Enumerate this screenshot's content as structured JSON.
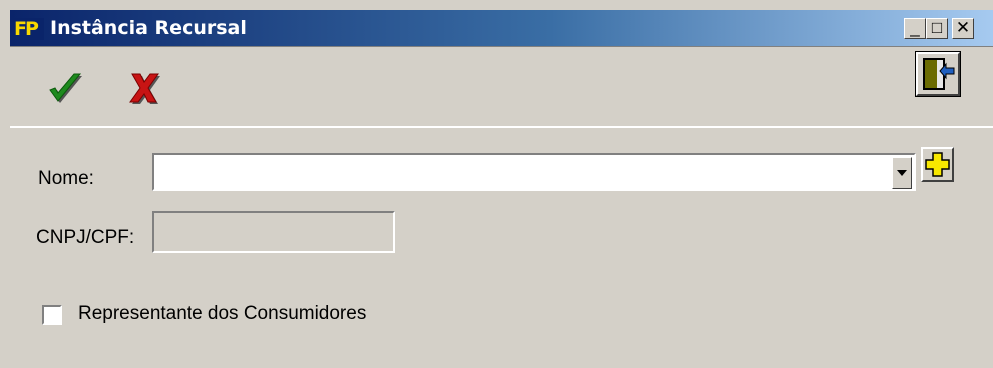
{
  "window": {
    "title": "Instância Recursal",
    "app_icon_text": "FP",
    "controls": {
      "minimize": "_",
      "maximize": "□",
      "close": "✕"
    }
  },
  "toolbar": {
    "confirm_icon": "check-icon",
    "cancel_icon": "x-icon",
    "exit_icon": "exit-door-icon",
    "confirm_color": "#1e8a1e",
    "cancel_color": "#c81414"
  },
  "form": {
    "nome_label": "Nome:",
    "nome_value": "",
    "cnpj_label": "CNPJ/CPF:",
    "cnpj_value": "",
    "checkbox_label": "Representante dos Consumidores",
    "checkbox_checked": false
  }
}
